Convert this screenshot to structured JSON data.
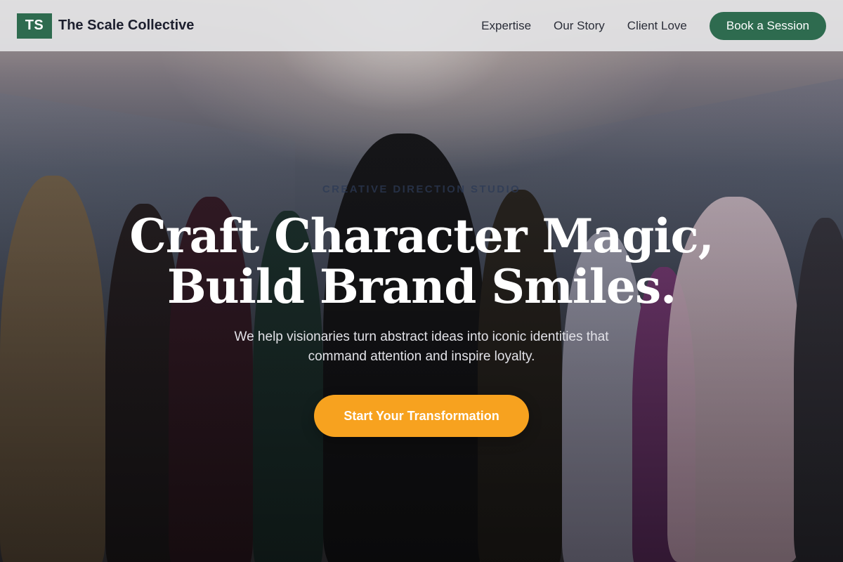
{
  "navbar": {
    "logo_initials": "TS",
    "brand_name": "The Scale Collective",
    "links": [
      {
        "label": "Expertise"
      },
      {
        "label": "Our Story"
      },
      {
        "label": "Client Love"
      }
    ],
    "cta_label": "Book a Session"
  },
  "hero": {
    "eyebrow": "CREATIVE DIRECTION STUDIO",
    "headline_line1": "Craft Character Magic,",
    "headline_line2": "Build Brand Smiles.",
    "subtext": "We help visionaries turn abstract ideas into iconic identities that command attention and inspire loyalty.",
    "cta_label": "Start Your Transformation"
  },
  "colors": {
    "brand_green": "#2e6b4f",
    "cta_orange": "#f7a21f",
    "navbar_bg": "#e2e2e4",
    "headline_text": "#ffffff"
  }
}
